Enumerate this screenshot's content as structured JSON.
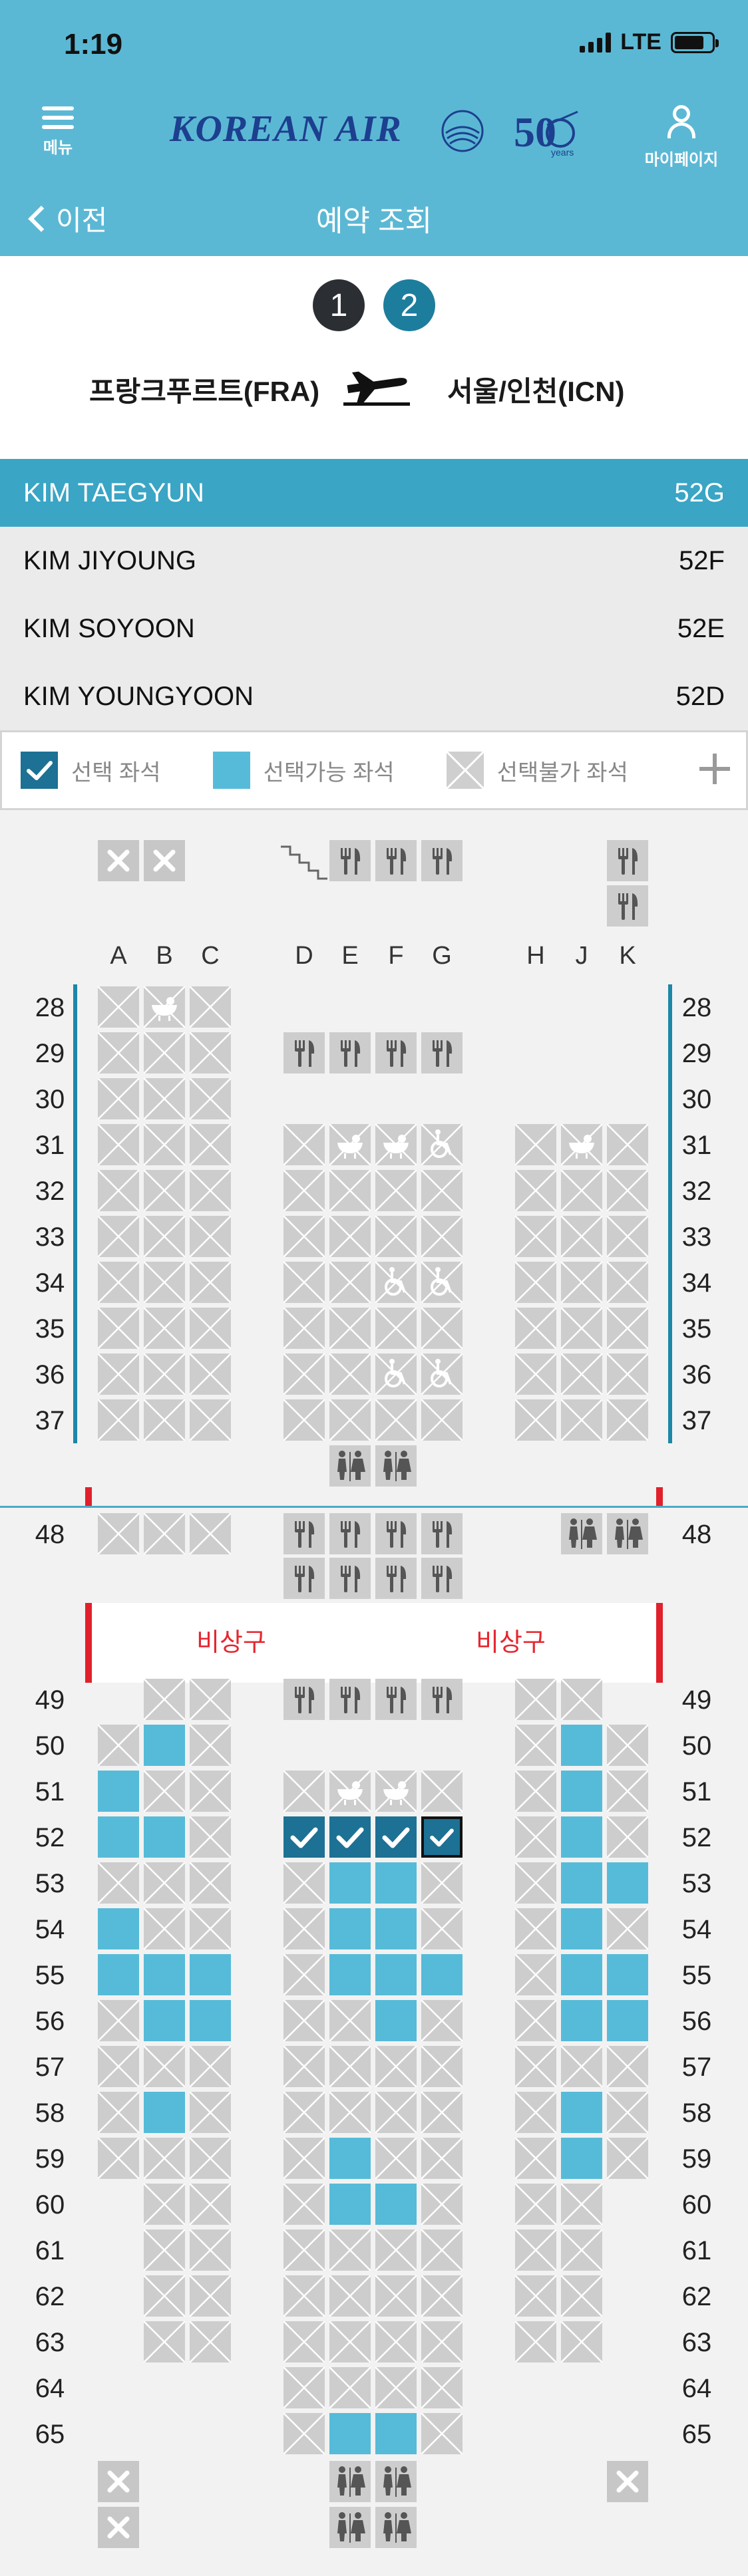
{
  "status": {
    "time": "1:19",
    "network": "LTE"
  },
  "nav": {
    "menu_label": "메뉴",
    "mypage_label": "마이페이지",
    "logo_text": "KOREAN AIR",
    "anniversary_text": "50",
    "anniversary_sub": "years",
    "back_label": "이전",
    "title": "예약 조회"
  },
  "route": {
    "steps": [
      "1",
      "2"
    ],
    "active_step": "2",
    "origin": "프랑크푸르트(FRA)",
    "destination": "서울/인천(ICN)"
  },
  "passengers": [
    {
      "name": "KIM TAEGYUN",
      "seat": "52G",
      "active": true
    },
    {
      "name": "KIM JIYOUNG",
      "seat": "52F",
      "active": false
    },
    {
      "name": "KIM SOYOON",
      "seat": "52E",
      "active": false
    },
    {
      "name": "KIM YOUNGYOON",
      "seat": "52D",
      "active": false
    }
  ],
  "legend": {
    "selected": "선택 좌석",
    "available": "선택가능 좌석",
    "unavailable": "선택불가 좌석"
  },
  "seatmap": {
    "columns": [
      "A",
      "B",
      "C",
      "D",
      "E",
      "F",
      "G",
      "H",
      "J",
      "K"
    ],
    "upper_rows": [
      "28",
      "29",
      "30",
      "31",
      "32",
      "33",
      "34",
      "35",
      "36",
      "37"
    ],
    "row_48": "48",
    "exit_label": "비상구",
    "lower_rows": [
      "49",
      "50",
      "51",
      "52",
      "53",
      "54",
      "55",
      "56",
      "57",
      "58",
      "59",
      "60",
      "61",
      "62",
      "63",
      "64",
      "65"
    ],
    "available_seats": [
      "50B",
      "51A",
      "52A",
      "52B",
      "54A",
      "55A",
      "55B",
      "55C",
      "56B",
      "56C",
      "58B",
      "53E",
      "53F",
      "54E",
      "54F",
      "55E",
      "55F",
      "55G",
      "56F",
      "59E",
      "60E",
      "60F",
      "65E",
      "65F",
      "50J",
      "51J",
      "52J",
      "53J",
      "53K",
      "54J",
      "55J",
      "55K",
      "56J",
      "56K",
      "58J",
      "59J"
    ],
    "selected_seats": [
      "52D",
      "52E",
      "52F",
      "52G"
    ],
    "current_seat": "52G",
    "colors": {
      "selected": "#1c7194",
      "available": "#56bbd8",
      "unavailable": "#cdcdcd",
      "accent": "#5bb8d4",
      "exit": "#e52730"
    }
  }
}
